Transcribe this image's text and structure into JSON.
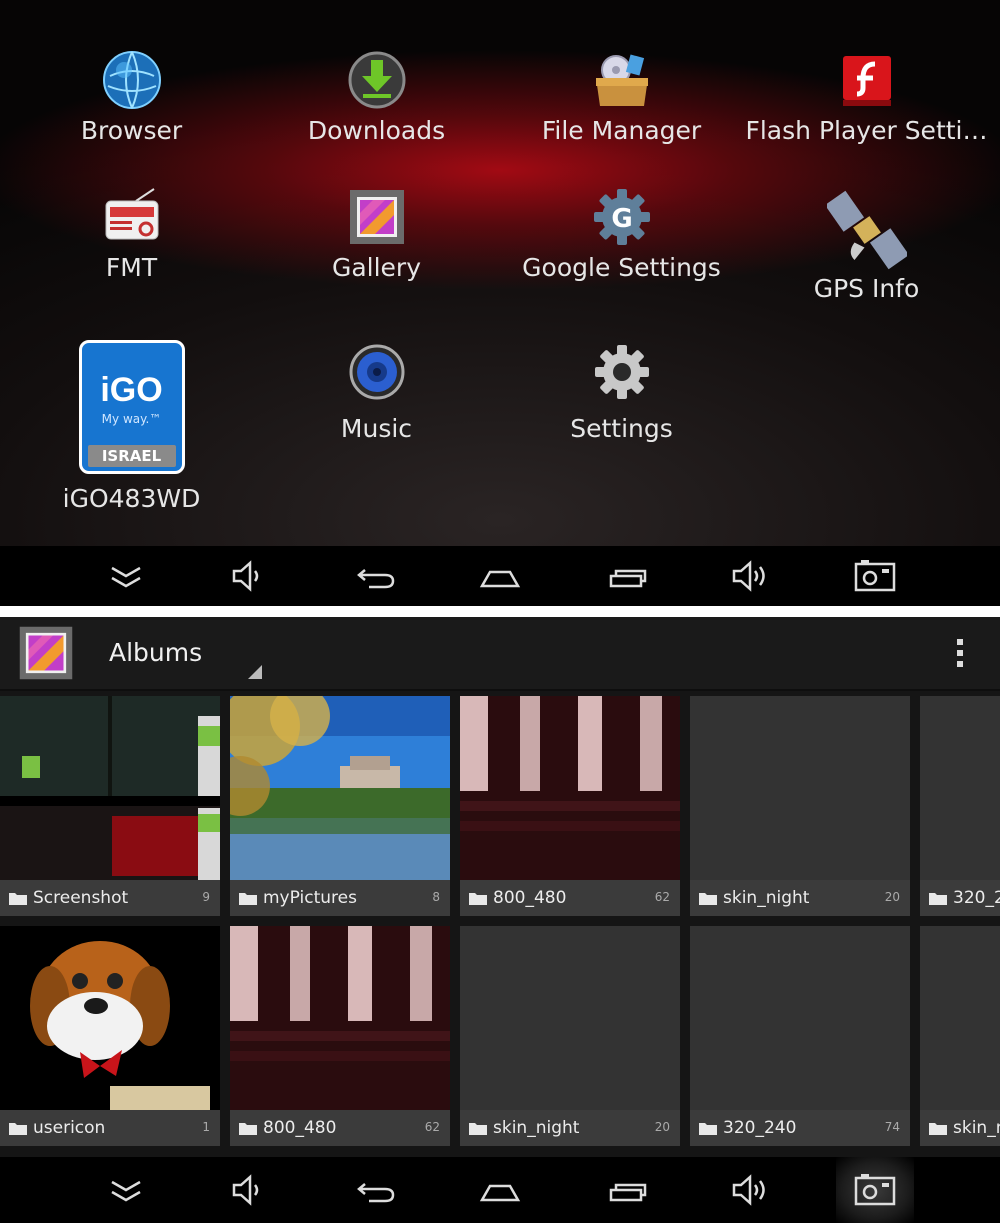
{
  "launcher": {
    "apps": [
      {
        "label": "Browser",
        "icon": "globe-icon"
      },
      {
        "label": "Downloads",
        "icon": "download-icon"
      },
      {
        "label": "File Manager",
        "icon": "file-manager-icon"
      },
      {
        "label": "Flash Player Setti…",
        "icon": "flash-icon"
      },
      {
        "label": "FMT",
        "icon": "radio-icon"
      },
      {
        "label": "Gallery",
        "icon": "gallery-icon"
      },
      {
        "label": "Google Settings",
        "icon": "google-settings-icon"
      },
      {
        "label": "GPS Info",
        "icon": "satellite-icon"
      },
      {
        "label": "iGO483WD",
        "icon": "igo-icon"
      },
      {
        "label": "Music",
        "icon": "speaker-icon"
      },
      {
        "label": "Settings",
        "icon": "gear-icon"
      }
    ],
    "igo_badge": {
      "brand": "iGO",
      "tagline": "My way.™",
      "region": "ISRAEL"
    }
  },
  "navbar": {
    "buttons": [
      "collapse-icon",
      "volume-down-icon",
      "back-icon",
      "home-icon",
      "recent-apps-icon",
      "volume-up-icon",
      "screenshot-icon"
    ]
  },
  "gallery": {
    "title": "Albums",
    "albums": [
      {
        "name": "Screenshot",
        "count": "9"
      },
      {
        "name": "myPictures",
        "count": "8"
      },
      {
        "name": "800_480",
        "count": "62"
      },
      {
        "name": "skin_night",
        "count": "20"
      },
      {
        "name": "320_2",
        "count": ""
      },
      {
        "name": "usericon",
        "count": "1"
      },
      {
        "name": "800_480",
        "count": "62"
      },
      {
        "name": "skin_night",
        "count": "20"
      },
      {
        "name": "320_240",
        "count": "74"
      },
      {
        "name": "skin_n",
        "count": ""
      }
    ]
  },
  "colors": {
    "accent_red": "#b0101a",
    "nav_bg": "#000000",
    "gallery_bg": "#151515"
  }
}
